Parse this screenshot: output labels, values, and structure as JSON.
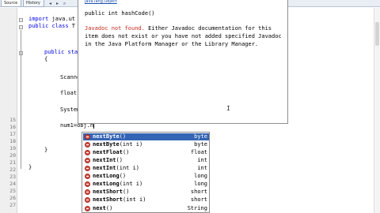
{
  "toolbar": {
    "tabs": [
      {
        "label": "Source"
      },
      {
        "label": "History"
      }
    ]
  },
  "gutter": {
    "line_numbers": [
      "",
      "",
      "",
      "",
      "",
      "",
      "",
      "",
      "",
      "",
      "",
      "",
      "",
      "",
      "15",
      "16",
      "17",
      "18",
      "19",
      "20",
      "21",
      "22",
      "23",
      "24",
      "25",
      "26",
      "27"
    ]
  },
  "editor": {
    "lines": [
      {
        "keyword": "import",
        "text": " java.ut"
      },
      {
        "keyword": "public class",
        "text": " T"
      },
      {
        "keyword": "",
        "text": ""
      },
      {
        "keyword": "public sta",
        "text": ""
      },
      {
        "keyword": "",
        "text": "{"
      },
      {
        "keyword": "",
        "text": "Scanne"
      },
      {
        "keyword": "",
        "text": "float ("
      },
      {
        "keyword": "",
        "text": "System"
      },
      {
        "keyword": "",
        "text": "num1=obj.n"
      },
      {
        "keyword": "",
        "text": "}"
      },
      {
        "keyword": "",
        "text": "}"
      }
    ]
  },
  "javadoc": {
    "link_text": "java.lang.Object",
    "signature": "public int hashCode()",
    "error_prefix": "Javadoc not found.",
    "message": " Either Javadoc documentation for this item does not exist or you have not added specified Javadoc in the Java Platform Manager or the Library Manager."
  },
  "completion": {
    "items": [
      {
        "bold": "nextByte",
        "rest": "()",
        "type": "byte",
        "selected": true
      },
      {
        "bold": "nextByte",
        "rest": "(int i)",
        "type": "byte",
        "selected": false
      },
      {
        "bold": "nextFloat",
        "rest": "()",
        "type": "float",
        "selected": false
      },
      {
        "bold": "nextInt",
        "rest": "()",
        "type": "int",
        "selected": false
      },
      {
        "bold": "nextInt",
        "rest": "(int i)",
        "type": "int",
        "selected": false
      },
      {
        "bold": "nextLong",
        "rest": "()",
        "type": "long",
        "selected": false
      },
      {
        "bold": "nextLong",
        "rest": "(int i)",
        "type": "long",
        "selected": false
      },
      {
        "bold": "nextShort",
        "rest": "()",
        "type": "short",
        "selected": false
      },
      {
        "bold": "nextShort",
        "rest": "(int i)",
        "type": "short",
        "selected": false
      },
      {
        "bold": "next",
        "rest": "()",
        "type": "String",
        "selected": false
      }
    ]
  },
  "colors": {
    "selection": "#3464b4",
    "keyword": "#0000e6",
    "error_text": "#c82a1e",
    "method_icon": "#d9544a"
  }
}
